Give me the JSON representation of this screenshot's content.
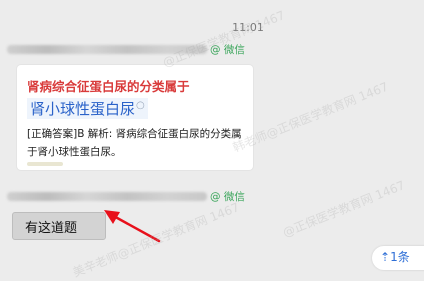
{
  "time": "11:01",
  "message1": {
    "source": "@ 微信"
  },
  "card": {
    "title": "肾病综合征蛋白尿的分类属于",
    "answer": "肾小球性蛋白尿",
    "explanation": "[正确答案]B 解析: 肾病综合征蛋白尿的分类属于肾小球性蛋白尿。"
  },
  "message2": {
    "source": "@ 微信"
  },
  "reply": {
    "text": "有这道题"
  },
  "unread": {
    "label": "1条"
  },
  "watermarks": [
    "@正保医学教育网 1467",
    "韩老师@正保医学教育网 1467",
    "美辛老师@正保医学教育网 1467",
    "@正保医学教育网 1467"
  ],
  "colors": {
    "arrow": "#e8101b",
    "source": "#3aa55a",
    "title": "#d93b3b",
    "answer": "#2a62c9"
  }
}
